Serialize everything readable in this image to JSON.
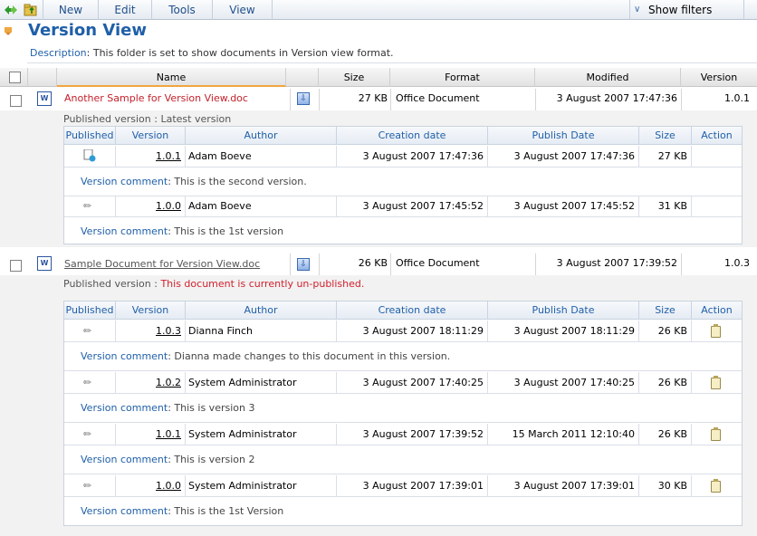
{
  "toolbar": {
    "buttons": [
      "New",
      "Edit",
      "Tools",
      "View"
    ],
    "filters_label": "Show filters",
    "icons": [
      "arrows-icon",
      "folder-up-icon"
    ]
  },
  "page": {
    "title": "Version View",
    "description_label": "Description",
    "description_text": ": This folder is set to show documents in Version view format."
  },
  "columns": [
    "Name",
    "Size",
    "Format",
    "Modified",
    "Version"
  ],
  "inner_columns": [
    "Published",
    "Version",
    "Author",
    "Creation date",
    "Publish Date",
    "Size",
    "Action"
  ],
  "documents": [
    {
      "name": "Another Sample for Version View.doc",
      "size": "27 KB",
      "format": "Office Document",
      "modified": "3 August 2007 17:47:36",
      "version": "1.0.1",
      "published_label": "Published version :",
      "published_status": "Latest version",
      "versions": [
        {
          "version": "1.0.1",
          "author": "Adam Boeve",
          "created": "3 August 2007 17:47:36",
          "published": "3 August 2007 17:47:36",
          "size": "27 KB",
          "comment_label": "Version comment",
          "comment": ": This is the second version."
        },
        {
          "version": "1.0.0",
          "author": "Adam Boeve",
          "created": "3 August 2007 17:45:52",
          "published": "3 August 2007 17:45:52",
          "size": "31 KB",
          "comment_label": "Version comment",
          "comment": ": This is the 1st version"
        }
      ]
    },
    {
      "name": "Sample Document for Version View.doc",
      "size": "26 KB",
      "format": "Office Document",
      "modified": "3 August 2007 17:39:52",
      "version": "1.0.3",
      "published_label": "Published version :",
      "published_status": "This document is currently un-published.",
      "versions": [
        {
          "version": "1.0.3",
          "author": "Dianna Finch",
          "created": "3 August 2007 18:11:29",
          "published": "3 August 2007 18:11:29",
          "size": "26 KB",
          "comment_label": "Version comment",
          "comment": ": Dianna made changes to this document in this version."
        },
        {
          "version": "1.0.2",
          "author": "System Administrator",
          "created": "3 August 2007 17:40:25",
          "published": "3 August 2007 17:40:25",
          "size": "26 KB",
          "comment_label": "Version comment",
          "comment": ": This is version 3"
        },
        {
          "version": "1.0.1",
          "author": "System Administrator",
          "created": "3 August 2007 17:39:52",
          "published": "15 March 2011 12:10:40",
          "size": "26 KB",
          "comment_label": "Version comment",
          "comment": ": This is version 2"
        },
        {
          "version": "1.0.0",
          "author": "System Administrator",
          "created": "3 August 2007 17:39:01",
          "published": "3 August 2007 17:39:01",
          "size": "30 KB",
          "comment_label": "Version comment",
          "comment": ": This is the 1st Version"
        }
      ]
    }
  ]
}
